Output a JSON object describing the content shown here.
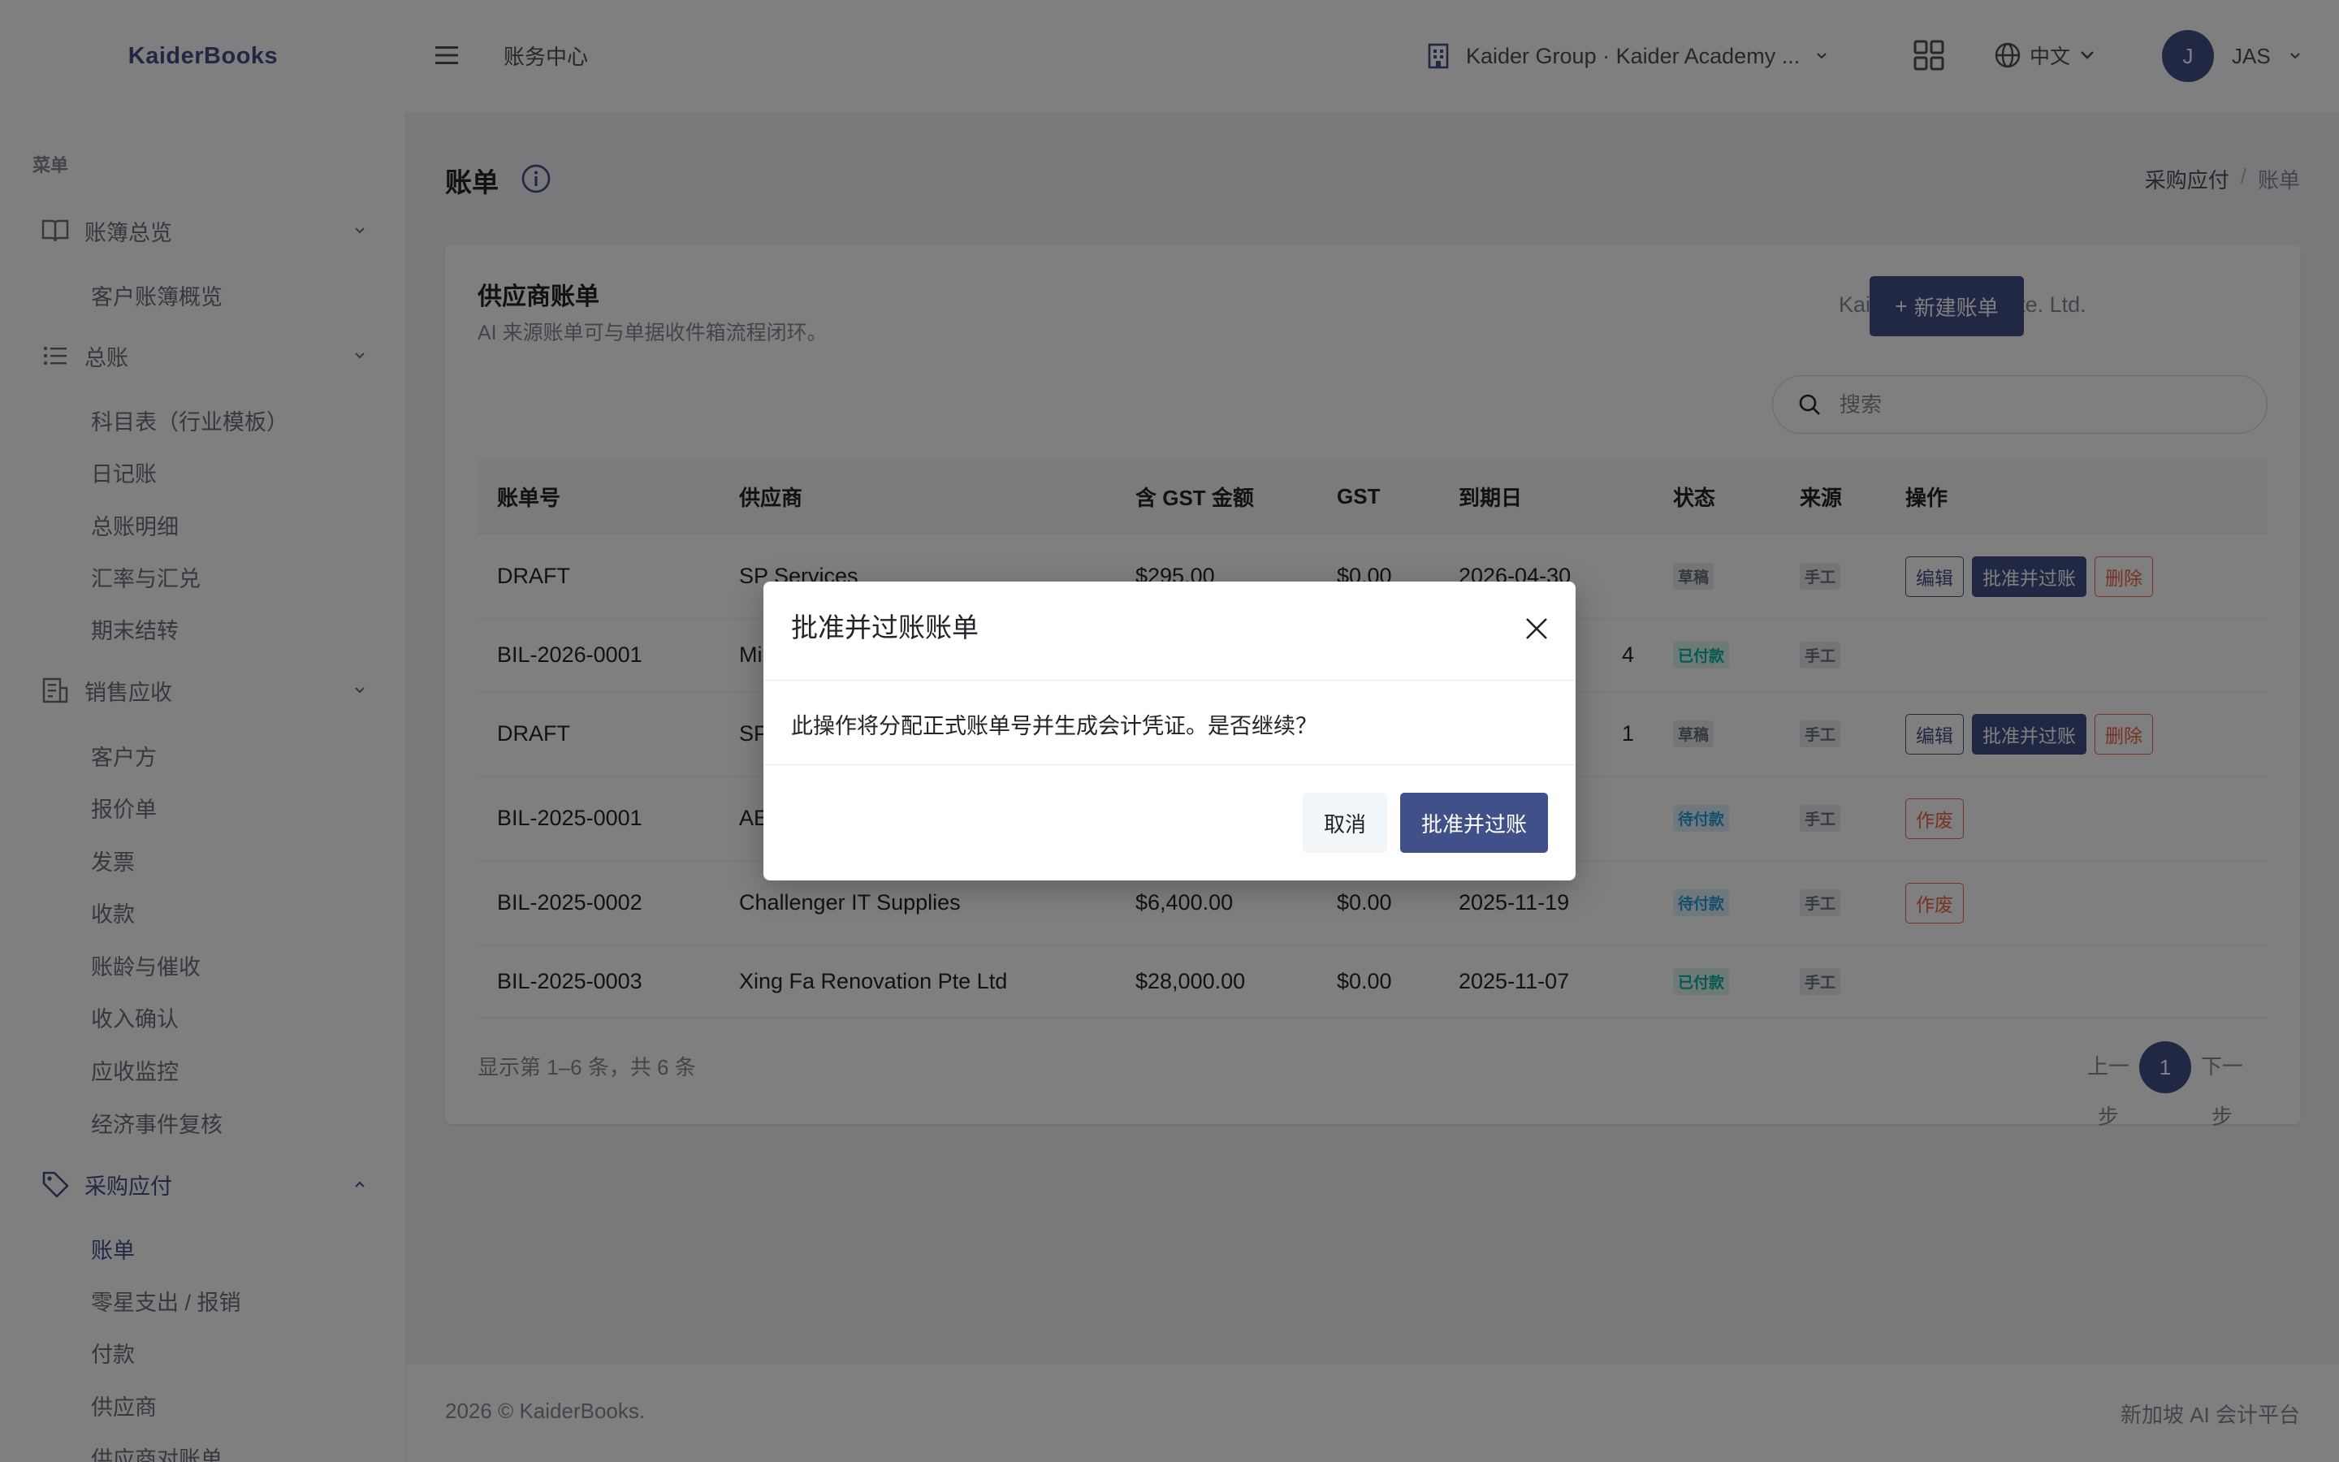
{
  "app": {
    "logo": "KaiderBooks"
  },
  "topbar": {
    "title": "账务中心",
    "company": "Kaider Group · Kaider Academy ...",
    "language": "中文",
    "user_initial": "J",
    "user_name": "JAS"
  },
  "sidebar": {
    "menu_title": "菜单",
    "groups": [
      {
        "label": "账簿总览",
        "items": [
          "客户账簿概览"
        ]
      },
      {
        "label": "总账",
        "items": [
          "科目表（行业模板）",
          "日记账",
          "总账明细",
          "汇率与汇兑",
          "期末结转"
        ]
      },
      {
        "label": "销售应收",
        "items": [
          "客户方",
          "报价单",
          "发票",
          "收款",
          "账龄与催收",
          "收入确认",
          "应收监控",
          "经济事件复核"
        ]
      },
      {
        "label": "采购应付",
        "items": [
          "账单",
          "零星支出 / 报销",
          "付款",
          "供应商",
          "供应商对账单"
        ]
      }
    ]
  },
  "page": {
    "title": "账单",
    "breadcrumb": [
      "采购应付",
      "账单"
    ]
  },
  "card": {
    "title": "供应商账单",
    "subtitle": "AI 来源账单可与单据收件箱流程闭环。",
    "company": "Kaider Academy Pte. Ltd.",
    "new_button": "新建账单",
    "search_placeholder": "搜索"
  },
  "table": {
    "headers": [
      "账单号",
      "供应商",
      "含 GST 金额",
      "GST",
      "到期日",
      "状态",
      "来源",
      "操作"
    ],
    "rows": [
      {
        "no": "DRAFT",
        "vendor": "SP Services",
        "amount": "$295.00",
        "gst": "$0.00",
        "due": "2026-04-30",
        "status": "草稿",
        "source": "手工"
      },
      {
        "no": "BIL-2026-0001",
        "vendor": "Mi",
        "amount": "",
        "gst": "",
        "due": "4",
        "status": "已付款",
        "source": "手工"
      },
      {
        "no": "DRAFT",
        "vendor": "SP",
        "amount": "",
        "gst": "",
        "due": "1",
        "status": "草稿",
        "source": "手工"
      },
      {
        "no": "BIL-2025-0001",
        "vendor": "AE",
        "amount": "",
        "gst": "",
        "due": "",
        "status": "待付款",
        "source": "手工"
      },
      {
        "no": "BIL-2025-0002",
        "vendor": "Challenger IT Supplies",
        "amount": "$6,400.00",
        "gst": "$0.00",
        "due": "2025-11-19",
        "status": "待付款",
        "source": "手工"
      },
      {
        "no": "BIL-2025-0003",
        "vendor": "Xing Fa Renovation Pte Ltd",
        "amount": "$28,000.00",
        "gst": "$0.00",
        "due": "2025-11-07",
        "status": "已付款",
        "source": "手工"
      }
    ],
    "actions": {
      "edit": "编辑",
      "approve": "批准并过账",
      "delete": "删除",
      "void": "作废"
    }
  },
  "pagination": {
    "summary": "显示第 1–6 条，共 6 条",
    "prev": "上一步",
    "page": "1",
    "next": "下一步"
  },
  "footer": {
    "copyright": "2026 © KaiderBooks.",
    "tagline": "新加坡 AI 会计平台"
  },
  "modal": {
    "title": "批准并过账账单",
    "message": "此操作将分配正式账单号并生成会计凭证。是否继续？",
    "cancel": "取消",
    "confirm": "批准并过账"
  },
  "colors": {
    "primary": "#405189",
    "success": "#0ab39c",
    "info": "#299cdb",
    "danger": "#f06548"
  }
}
